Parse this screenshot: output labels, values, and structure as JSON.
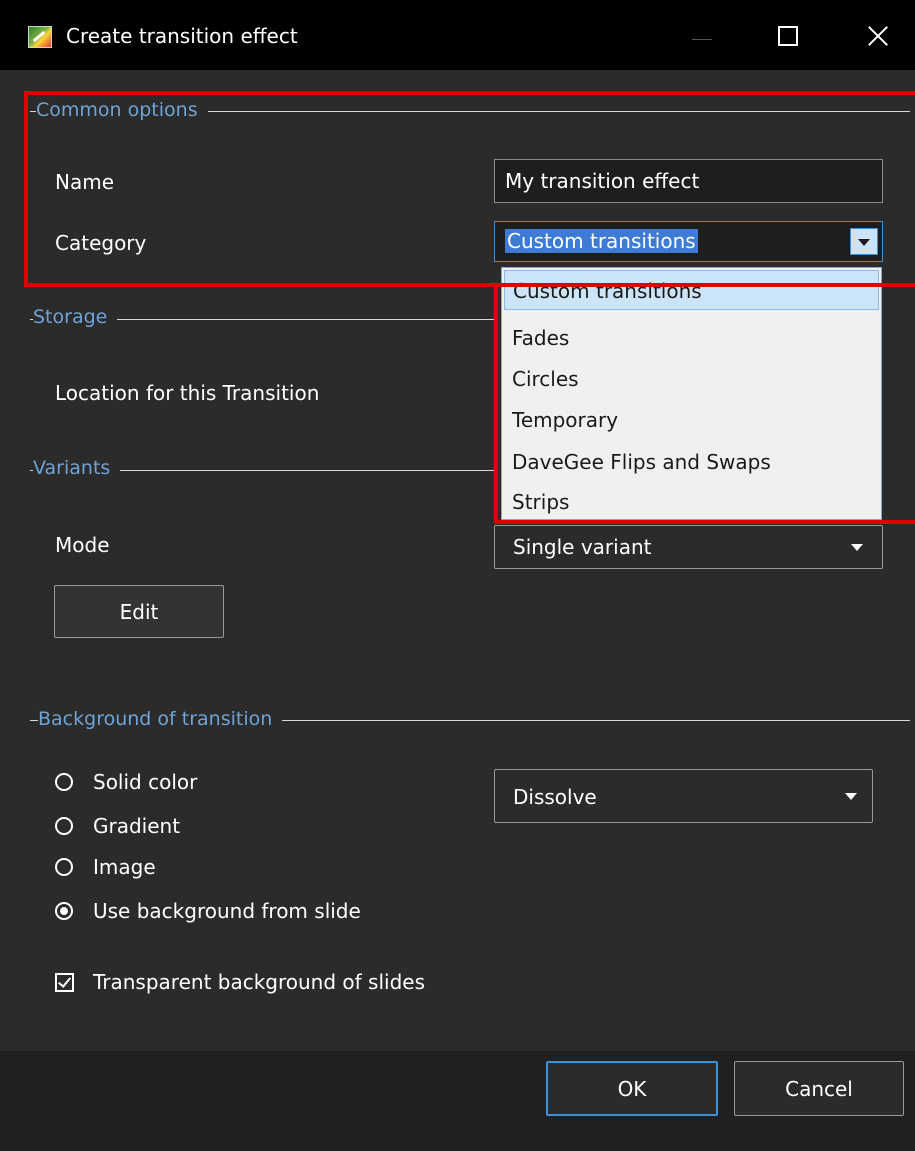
{
  "window": {
    "title": "Create transition effect",
    "icons": {
      "app": "app-icon",
      "minimize": "minimize-icon",
      "maximize": "maximize-icon",
      "close": "close-icon"
    }
  },
  "common_options": {
    "group_label": "Common options",
    "name_label": "Name",
    "name_value": "My transition effect",
    "category_label": "Category",
    "category_value": "Custom transitions",
    "category_options": [
      "Custom transitions",
      "Fades",
      "Circles",
      "Temporary",
      "DaveGee Flips and Swaps",
      "Strips"
    ],
    "selected_option": "Custom transitions"
  },
  "storage": {
    "group_label": "Storage",
    "location_label": "Location for this Transition"
  },
  "variants": {
    "group_label": "Variants",
    "mode_label": "Mode",
    "mode_value": "Single variant",
    "edit_label": "Edit"
  },
  "background": {
    "group_label": "Background of transition",
    "options": [
      "Solid color",
      "Gradient",
      "Image",
      "Use background from slide"
    ],
    "selected": "Use background from slide",
    "effect_value": "Dissolve",
    "transparent_label": "Transparent background of slides",
    "transparent_checked": true
  },
  "footer": {
    "ok_label": "OK",
    "cancel_label": "Cancel"
  },
  "colors": {
    "highlight": "#e00000",
    "accent": "#3d8fd6",
    "group_label": "#6fa3d6",
    "background": "#2b2b2b"
  }
}
